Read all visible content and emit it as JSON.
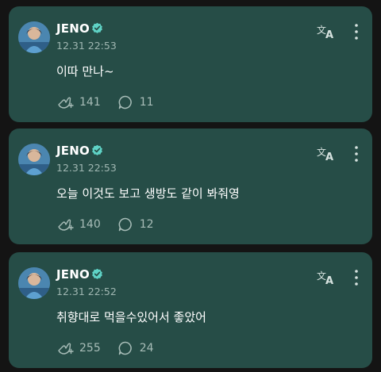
{
  "posts": [
    {
      "author": "JENO",
      "timestamp": "12.31 22:53",
      "text": "이따 만나~",
      "reactions": "141",
      "comments": "11"
    },
    {
      "author": "JENO",
      "timestamp": "12.31 22:53",
      "text": "오늘 이것도 보고 생방도 같이 봐줘영",
      "reactions": "140",
      "comments": "12"
    },
    {
      "author": "JENO",
      "timestamp": "12.31 22:52",
      "text": "취향대로 먹을수있어서 좋았어",
      "reactions": "255",
      "comments": "24"
    }
  ],
  "icons": {
    "verified": "verified-badge-icon",
    "translate": "translate-icon",
    "more": "more-vertical-icon",
    "reaction": "reaction-add-icon",
    "comment": "comment-bubble-icon"
  },
  "colors": {
    "background": "#141414",
    "card": "#264d47",
    "verified": "#5fd3c6",
    "muted_text": "#a8bdb8"
  }
}
